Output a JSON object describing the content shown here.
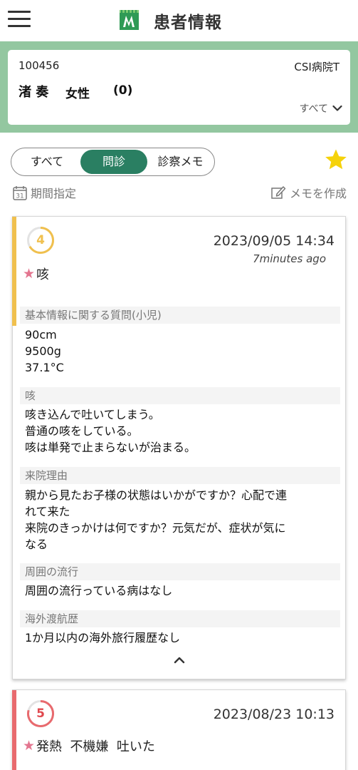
{
  "header": {
    "title": "患者情報",
    "menu_icon": "hamburger-icon",
    "logo_icon": "app-logo"
  },
  "patient": {
    "id": "100456",
    "hospital": "CSI病院T",
    "name": "渚 奏",
    "sex": "女性",
    "age": "(0)",
    "filter_label": "すべて"
  },
  "tabs": [
    {
      "label": "すべて",
      "selected": false
    },
    {
      "label": "問診",
      "selected": true
    },
    {
      "label": "診察メモ",
      "selected": false
    }
  ],
  "toolbar": {
    "period_label": "期間指定",
    "calendar_day": "31",
    "memo_label": "メモを作成"
  },
  "colors": {
    "brand_green": "#2a7f62",
    "band_green": "#93c7a0",
    "star_yellow": "#f5d20b",
    "pink_star": "#e3758f",
    "yellow_bar": "#f0c04e",
    "red_bar": "#e86a6e"
  },
  "records": [
    {
      "count": "4",
      "date": "2023/09/05 14:34",
      "ago": "7minutes ago",
      "symptom": "咳",
      "sections": [
        {
          "label": "基本情報に関する質問(小児)",
          "lines": [
            "90cm",
            "9500g",
            "37.1°C"
          ]
        },
        {
          "label": "咳",
          "lines": [
            "咳き込んで吐いてしまう。",
            "普通の咳をしている。",
            "咳は単発で止まらないが治まる。"
          ]
        },
        {
          "label": "来院理由",
          "lines": [
            "親から見たお子様の状態はいかがですか？心配で連",
            "れて来た",
            "来院のきっかけは何ですか？元気だが、症状が気に",
            "なる"
          ]
        },
        {
          "label": "周囲の流行",
          "lines": [
            "周囲の流行っている病はなし"
          ]
        },
        {
          "label": "海外渡航歴",
          "lines": [
            "1か月以内の海外旅行履歴なし"
          ]
        }
      ]
    },
    {
      "count": "5",
      "date": "2023/08/23 10:13",
      "symptom": "発熱  不機嫌  吐いた"
    }
  ]
}
